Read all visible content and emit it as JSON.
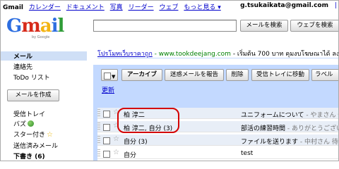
{
  "topbar": {
    "brand": "Gmail",
    "links": [
      "カレンダー",
      "ドキュメント",
      "写真",
      "リーダー",
      "ウェブ",
      "もっと見る ▾"
    ],
    "account": "g.tsukaikata@gmail.com",
    "account_more": "|"
  },
  "logo": {
    "letters": [
      "G",
      "m",
      "a",
      "i",
      "l"
    ],
    "byline": "by Google"
  },
  "search": {
    "value": "",
    "mail_button": "メールを検索",
    "web_button": "ウェブを検索"
  },
  "nav": {
    "mail": "メール",
    "contacts": "連絡先",
    "tasks": "ToDo リスト",
    "compose": "メールを作成",
    "inbox": "受信トレイ",
    "buzz": "バズ",
    "starred": "スター付き",
    "sent": "送信済みメール",
    "drafts": "下書き (6)"
  },
  "ad": {
    "link": "โปรโมทเว็บราคาถูก",
    "url": " - www.tookdeejang.com",
    "text": " - เริ่มต้น 700 บาท คุมงบโฆษณาได้ ลงโฆษณาได้ทุกหน้าขอ"
  },
  "toolbar": {
    "archive": "アーカイブ",
    "spam": "迷惑メールを報告",
    "delete": "削除",
    "move_to_inbox": "受信トレイに移動",
    "label": "ラベル",
    "refresh": "更新"
  },
  "messages": [
    {
      "sender": "柏 淳二",
      "subject": "ユニフォームについて",
      "snippet": " - やまさん 作",
      "read": true
    },
    {
      "sender": "柏 淳二, 自分 (3)",
      "subject": "部活の練習時間",
      "snippet": " - ありがとうございます",
      "read": true
    },
    {
      "sender": "自分 (3)",
      "subject": "ファイルを送ります",
      "snippet": " - 中村さん 待ち",
      "read": true
    },
    {
      "sender": "自分",
      "subject": "test",
      "snippet": "",
      "read": false
    }
  ],
  "colors": {
    "highlight": "#d40000",
    "panel": "#c3d9ff",
    "inbox_selected": "#cfdff6"
  }
}
